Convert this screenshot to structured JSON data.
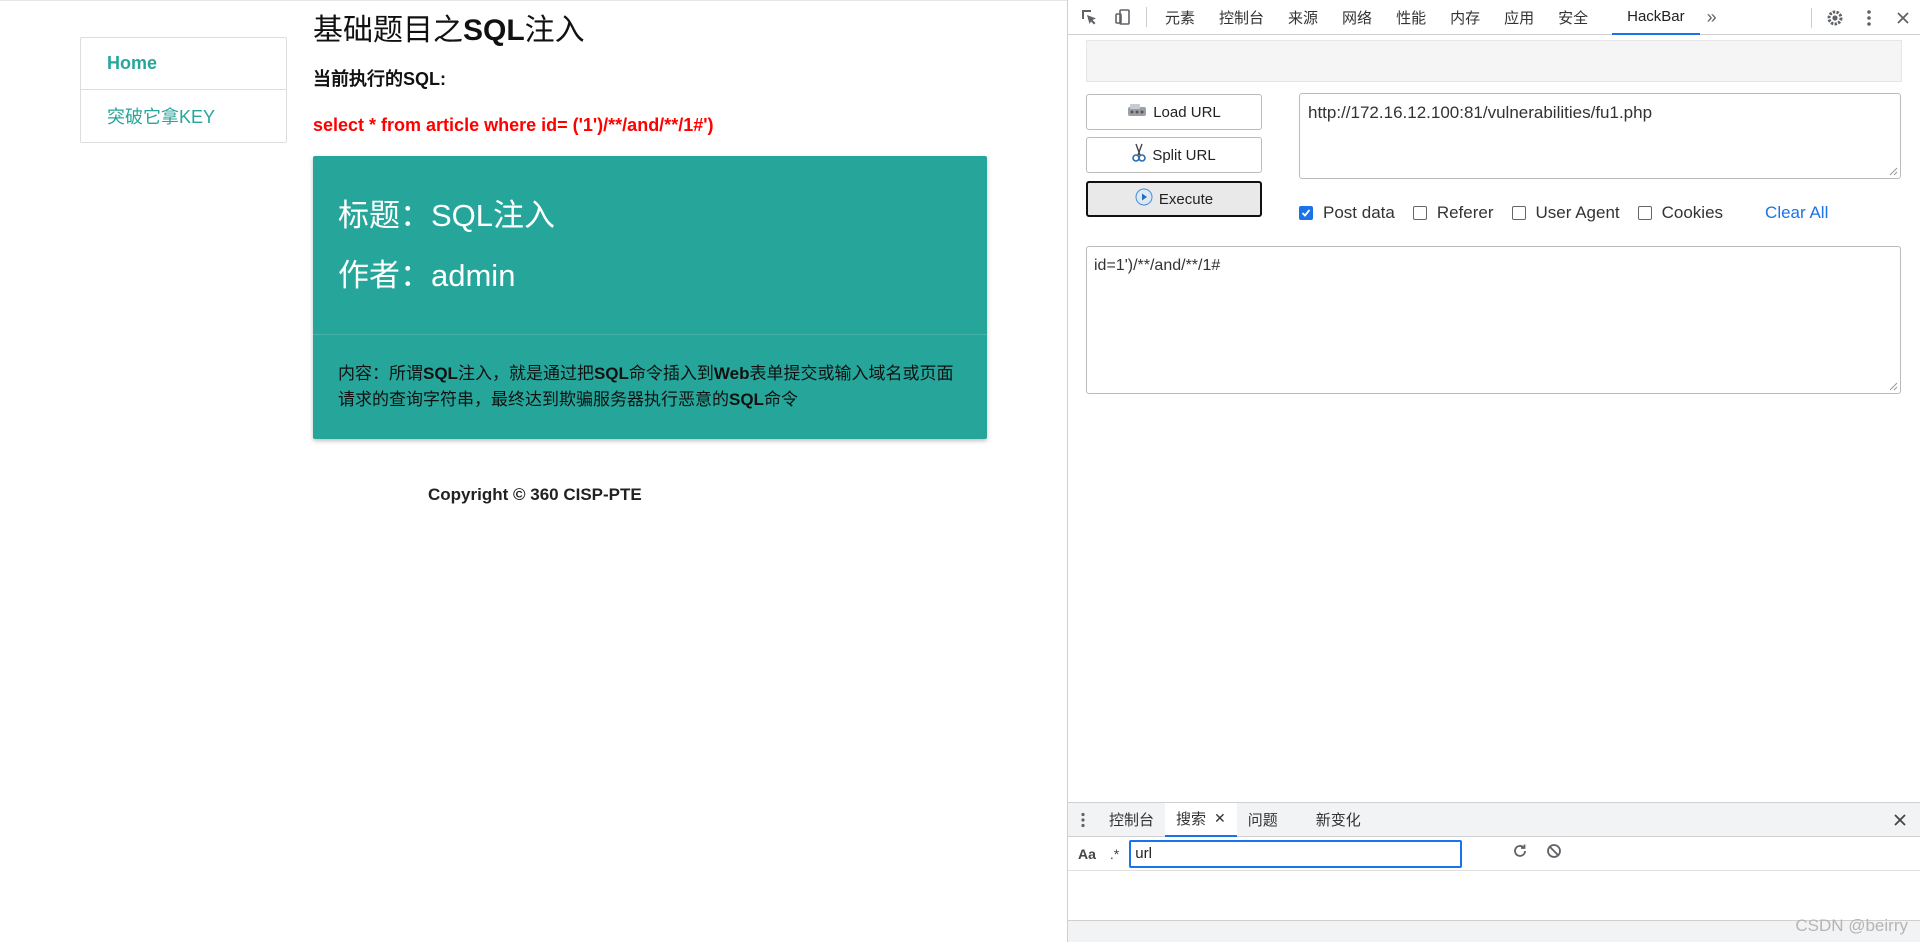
{
  "sidebar": {
    "items": [
      {
        "label": "Home"
      },
      {
        "label": "突破它拿KEY"
      }
    ]
  },
  "main": {
    "title_prefix": "基础题目之",
    "title_bold": "SQL",
    "title_suffix": "注入",
    "sql_label": "当前执行的SQL:",
    "sql_text": "select * from article where id= ('1')/**/and/**/1#')",
    "card": {
      "title_line": "标题：SQL注入",
      "author_line": "作者：admin",
      "content_parts": [
        "内容：所谓",
        "SQL",
        "注入，就是通过把",
        "SQL",
        "命令插入到",
        "Web",
        "表单提交或输入域名或页面请求的查询字符串，最终达到欺骗服务器执行恶意的",
        "SQL",
        "命令"
      ]
    },
    "copyright": "Copyright © 360 CISP-PTE"
  },
  "devtools": {
    "tabs": [
      "元素",
      "控制台",
      "来源",
      "网络",
      "性能",
      "内存",
      "应用",
      "安全",
      "HackBar"
    ],
    "active_tab": "HackBar",
    "hackbar": {
      "load_url": "Load URL",
      "split_url": "Split URL",
      "execute": "Execute",
      "url_value": "http://172.16.12.100:81/vulnerabilities/fu1.php",
      "options": [
        {
          "label": "Post data",
          "checked": true
        },
        {
          "label": "Referer",
          "checked": false
        },
        {
          "label": "User Agent",
          "checked": false
        },
        {
          "label": "Cookies",
          "checked": false
        }
      ],
      "clear_all": "Clear All",
      "post_value": "id=1')/**/and/**/1#"
    },
    "drawer": {
      "tabs": [
        "控制台",
        "搜索",
        "问题",
        "新变化"
      ],
      "active_tab": "搜索",
      "case_toggle": "Aa",
      "regex_toggle": ".*",
      "search_value": "url"
    }
  },
  "watermark": "CSDN @beirry",
  "colors": {
    "accent": "#26a69a",
    "sql_red": "#ff0000",
    "devtools_blue": "#1a73e8"
  }
}
